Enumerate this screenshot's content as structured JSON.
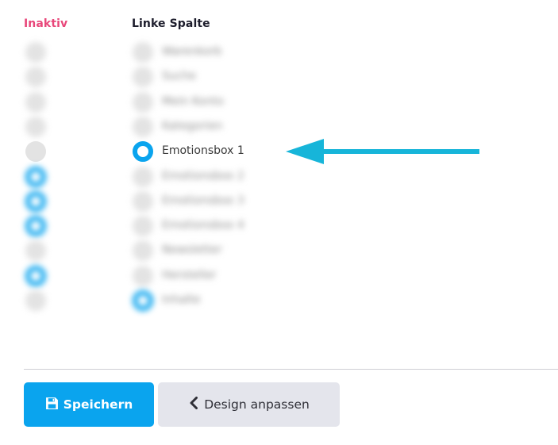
{
  "columns": {
    "inactive_label": "Inaktiv",
    "left_column_label": "Linke Spalte"
  },
  "rows": [
    {
      "label": "Warenkorb",
      "inactive_selected": false,
      "left_selected": false,
      "blurred": true
    },
    {
      "label": "Suche",
      "inactive_selected": false,
      "left_selected": false,
      "blurred": true
    },
    {
      "label": "Mein Konto",
      "inactive_selected": false,
      "left_selected": false,
      "blurred": true
    },
    {
      "label": "Kategorien",
      "inactive_selected": false,
      "left_selected": false,
      "blurred": true
    },
    {
      "label": "Emotionsbox 1",
      "inactive_selected": false,
      "left_selected": true,
      "blurred": false
    },
    {
      "label": "Emotionsbox 2",
      "inactive_selected": true,
      "left_selected": false,
      "blurred": true
    },
    {
      "label": "Emotionsbox 3",
      "inactive_selected": true,
      "left_selected": false,
      "blurred": true
    },
    {
      "label": "Emotionsbox 4",
      "inactive_selected": true,
      "left_selected": false,
      "blurred": true
    },
    {
      "label": "Newsletter",
      "inactive_selected": false,
      "left_selected": false,
      "blurred": true
    },
    {
      "label": "Hersteller",
      "inactive_selected": true,
      "left_selected": false,
      "blurred": true
    },
    {
      "label": "Inhalte",
      "inactive_selected": false,
      "left_selected": true,
      "blurred": true
    }
  ],
  "buttons": {
    "save_label": "Speichern",
    "design_label": "Design anpassen",
    "save_icon": "floppy-disk-icon",
    "design_icon": "chevron-left-icon"
  },
  "annotation": {
    "arrow_icon": "arrow-left-icon",
    "arrow_color": "#17b5d9"
  },
  "colors": {
    "inactive_header": "#e8477a",
    "accent": "#0aa4ee",
    "secondary_button": "#e4e5ec"
  }
}
